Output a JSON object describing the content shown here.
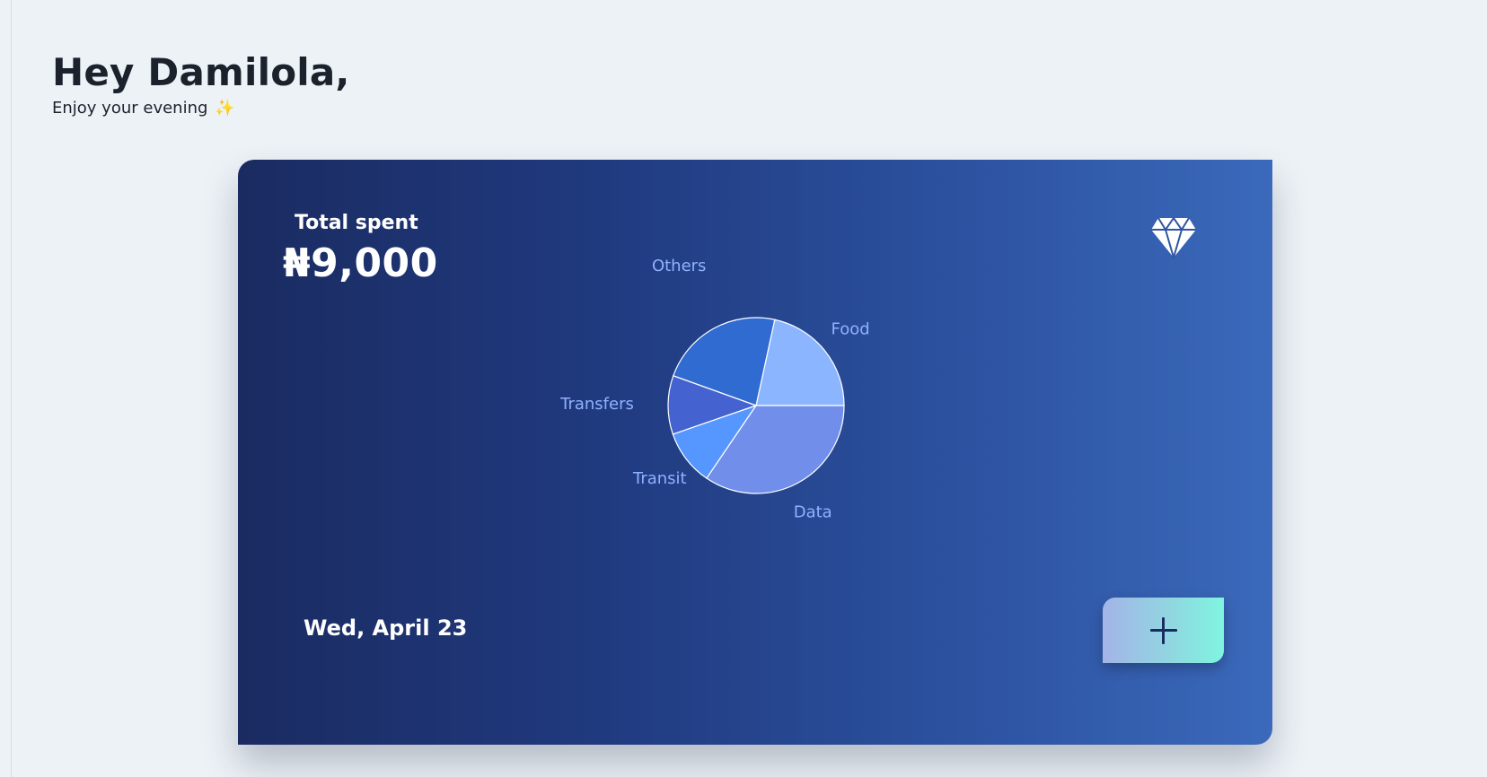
{
  "greeting": {
    "title": "Hey Damilola,",
    "subtitle": "Enjoy your evening",
    "subtitle_emoji": "✨"
  },
  "card": {
    "total_label": "Total spent",
    "total_amount": "₦9,000",
    "date": "Wed, April 23",
    "add_button_icon": "plus-icon",
    "badge_icon": "diamond-icon"
  },
  "chart_data": {
    "type": "pie",
    "categories": [
      "Food",
      "Others",
      "Transfers",
      "Transit",
      "Data"
    ],
    "values": [
      21.6,
      22.9,
      10.8,
      10.2,
      34.5
    ],
    "colors": [
      "#8cb5ff",
      "#2f6bd0",
      "#4462d0",
      "#5596ff",
      "#718fea"
    ],
    "label_color": "#8fb1ff",
    "stroke_color": "#ffffff"
  }
}
